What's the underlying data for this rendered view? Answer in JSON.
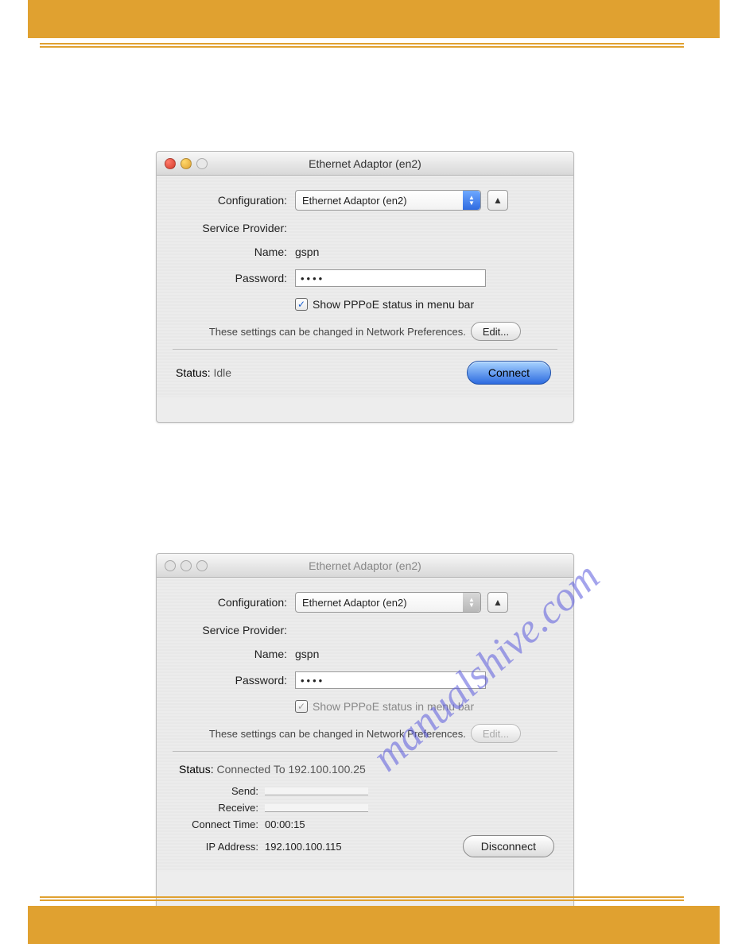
{
  "watermark_text": "manualshive.com",
  "window1": {
    "title": "Ethernet Adaptor (en2)",
    "labels": {
      "configuration": "Configuration:",
      "service_provider": "Service Provider:",
      "name": "Name:",
      "password": "Password:",
      "status": "Status:"
    },
    "values": {
      "configuration_selected": "Ethernet Adaptor (en2)",
      "name": "gspn",
      "password_masked": "••••",
      "status": "Idle"
    },
    "checkbox_label": "Show PPPoE status in menu bar",
    "hint_text": "These settings can be changed in Network Preferences.",
    "edit_button": "Edit...",
    "connect_button": "Connect"
  },
  "window2": {
    "title": "Ethernet Adaptor (en2)",
    "labels": {
      "configuration": "Configuration:",
      "service_provider": "Service Provider:",
      "name": "Name:",
      "password": "Password:",
      "status": "Status:",
      "send": "Send:",
      "receive": "Receive:",
      "connect_time": "Connect Time:",
      "ip_address": "IP Address:"
    },
    "values": {
      "configuration_selected": "Ethernet Adaptor (en2)",
      "name": "gspn",
      "password_masked": "••••",
      "status": "Connected To 192.100.100.25",
      "connect_time": "00:00:15",
      "ip_address": "192.100.100.115"
    },
    "checkbox_label": "Show PPPoE status in menu bar",
    "hint_text": "These settings can be changed in Network Preferences.",
    "edit_button": "Edit...",
    "disconnect_button": "Disconnect"
  }
}
